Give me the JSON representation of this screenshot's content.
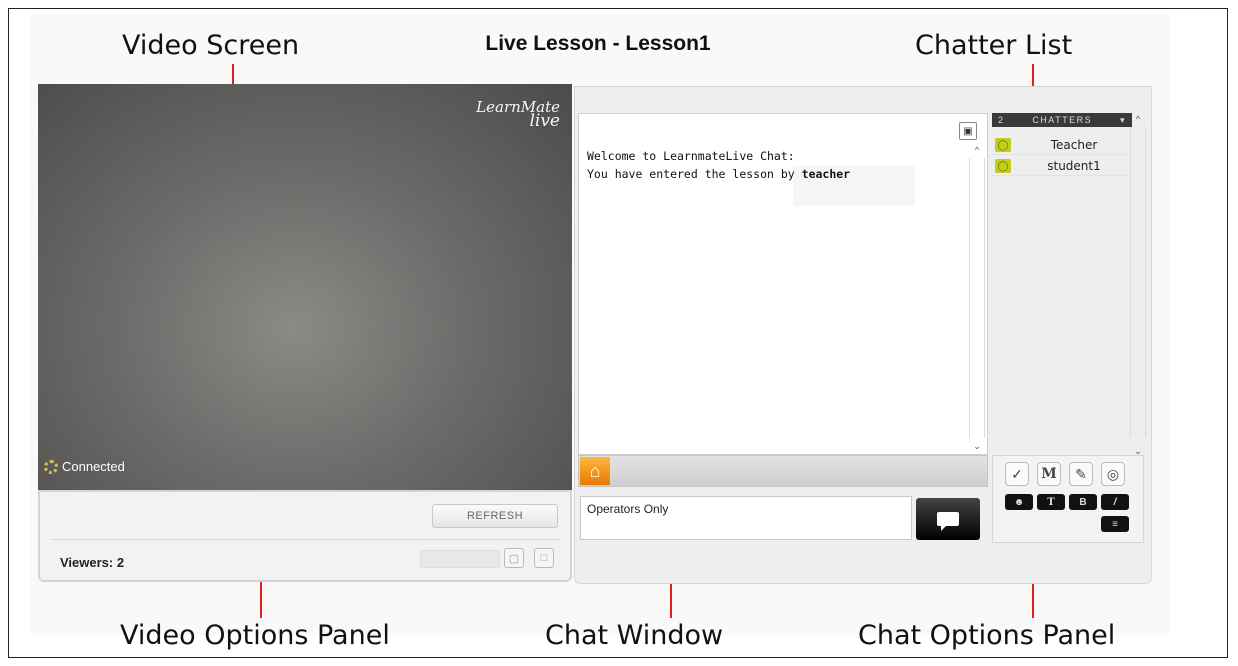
{
  "page_title": "Live Lesson - Lesson1",
  "annotations": {
    "video_screen": "Video Screen",
    "chatter_list": "Chatter List",
    "video_options_panel": "Video Options Panel",
    "chat_window": "Chat Window",
    "chat_options_panel": "Chat Options Panel"
  },
  "video": {
    "logo_top": "LearnMate",
    "logo_bottom": "live",
    "status": "Connected"
  },
  "video_options": {
    "refresh_label": "REFRESH",
    "viewers": "Viewers: 2"
  },
  "chat": {
    "welcome": "Welcome to LearnmateLive Chat:",
    "entered_prefix": "You have entered the  lesson by ",
    "entered_user": "teacher",
    "input_value": "Operators Only"
  },
  "chatters": {
    "count": "2",
    "header": "CHATTERS",
    "items": [
      {
        "name": "Teacher"
      },
      {
        "name": "student1"
      }
    ]
  },
  "chat_options": {
    "icons": [
      "check-circle-icon",
      "m-icon",
      "pencil-icon",
      "globe-icon"
    ],
    "format_buttons": [
      "smiley-icon",
      "font-icon",
      "bold-icon",
      "italic-icon",
      "size-icon"
    ]
  },
  "colors": {
    "annotation_line": "#e02020",
    "home_button": "#f29000",
    "status_icon": "#c4cd1d"
  }
}
